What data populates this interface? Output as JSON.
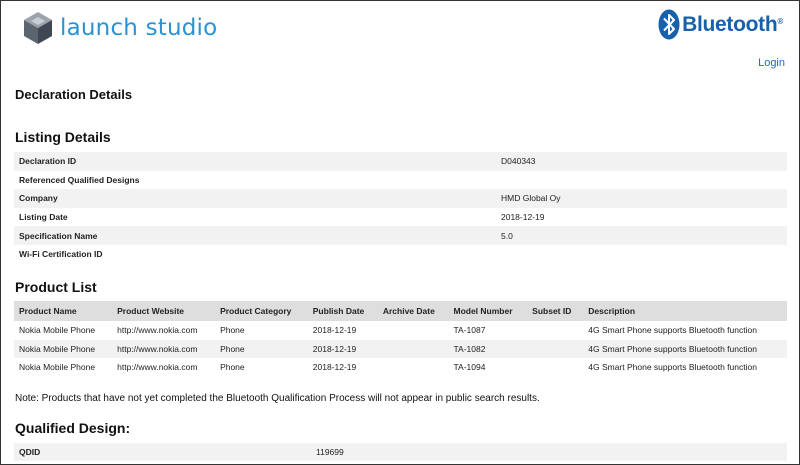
{
  "brand": {
    "name": "launch studio",
    "partner": "Bluetooth",
    "partner_mark": "®"
  },
  "nav": {
    "login": "Login"
  },
  "page_title": "Declaration Details",
  "listing": {
    "title": "Listing Details",
    "rows": [
      {
        "label": "Declaration ID",
        "value": "D040343"
      },
      {
        "label": "Referenced Qualified Designs",
        "value": ""
      },
      {
        "label": "Company",
        "value": "HMD Global Oy"
      },
      {
        "label": "Listing Date",
        "value": "2018-12-19"
      },
      {
        "label": "Specification Name",
        "value": "5.0"
      },
      {
        "label": "Wi-Fi Certification ID",
        "value": ""
      }
    ]
  },
  "product_list": {
    "title": "Product List",
    "columns": [
      "Product Name",
      "Product Website",
      "Product Category",
      "Publish Date",
      "Archive Date",
      "Model Number",
      "Subset ID",
      "Description"
    ],
    "rows": [
      [
        "Nokia Mobile Phone",
        "http://www.nokia.com",
        "Phone",
        "2018-12-19",
        "",
        "TA-1087",
        "",
        "4G Smart Phone supports Bluetooth function"
      ],
      [
        "Nokia Mobile Phone",
        "http://www.nokia.com",
        "Phone",
        "2018-12-19",
        "",
        "TA-1082",
        "",
        "4G Smart Phone supports Bluetooth function"
      ],
      [
        "Nokia Mobile Phone",
        "http://www.nokia.com",
        "Phone",
        "2018-12-19",
        "",
        "TA-1094",
        "",
        "4G Smart Phone supports Bluetooth function"
      ]
    ]
  },
  "note": "Note: Products that have not yet completed the Bluetooth Qualification Process will not appear in public search results.",
  "qualified": {
    "title": "Qualified Design:",
    "rows": [
      {
        "label": "QDID",
        "value": "119699"
      }
    ]
  },
  "colors": {
    "launch_blue": "#2b93d1",
    "bt_blue": "#1760ab",
    "link": "#1a6bc6",
    "row_stripe": "#f2f2f2",
    "header_bg": "#dedede"
  },
  "icons": {
    "logo": "launch-studio-cube-icon",
    "partner": "bluetooth-rune-icon"
  }
}
